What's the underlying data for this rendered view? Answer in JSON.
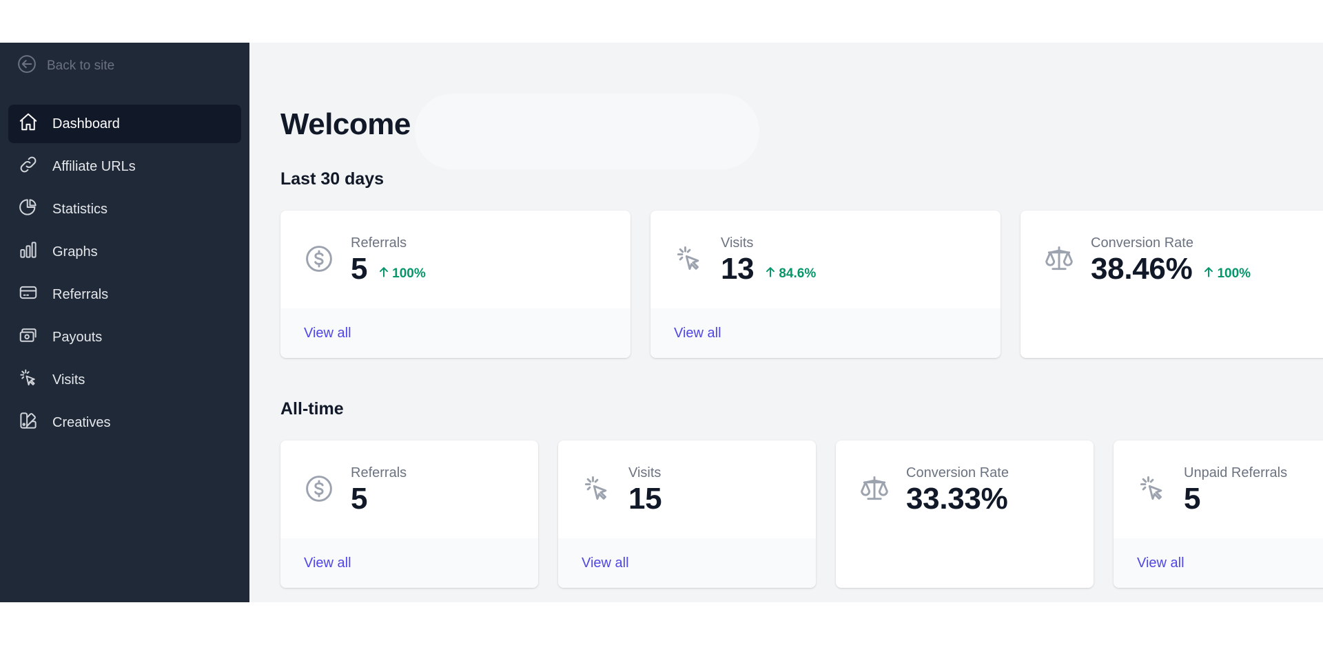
{
  "sidebar": {
    "back_label": "Back to site",
    "items": [
      {
        "label": "Dashboard",
        "icon": "home-icon",
        "active": true
      },
      {
        "label": "Affiliate URLs",
        "icon": "link-icon"
      },
      {
        "label": "Statistics",
        "icon": "pie-chart-icon"
      },
      {
        "label": "Graphs",
        "icon": "bar-chart-icon"
      },
      {
        "label": "Referrals",
        "icon": "credit-card-icon"
      },
      {
        "label": "Payouts",
        "icon": "cash-icon"
      },
      {
        "label": "Visits",
        "icon": "cursor-click-icon"
      },
      {
        "label": "Creatives",
        "icon": "color-swatch-icon"
      }
    ]
  },
  "main": {
    "welcome": "Welcome",
    "last30": {
      "title": "Last 30 days",
      "cards": [
        {
          "label": "Referrals",
          "value": "5",
          "change": "100%",
          "icon": "dollar-circle-icon",
          "link": "View all"
        },
        {
          "label": "Visits",
          "value": "13",
          "change": "84.6%",
          "icon": "cursor-click-icon",
          "link": "View all"
        },
        {
          "label": "Conversion Rate",
          "value": "38.46%",
          "change": "100%",
          "icon": "scale-icon"
        }
      ]
    },
    "alltime": {
      "title": "All-time",
      "cards": [
        {
          "label": "Referrals",
          "value": "5",
          "icon": "dollar-circle-icon",
          "link": "View all"
        },
        {
          "label": "Visits",
          "value": "15",
          "icon": "cursor-click-icon",
          "link": "View all"
        },
        {
          "label": "Conversion Rate",
          "value": "33.33%",
          "icon": "scale-icon"
        },
        {
          "label": "Unpaid Referrals",
          "value": "5",
          "icon": "cursor-click-icon",
          "link": "View all"
        }
      ]
    }
  },
  "colors": {
    "sidebar_bg": "#1f2937",
    "sidebar_active": "#111827",
    "main_bg": "#f3f4f6",
    "positive": "#059669",
    "link": "#4f46e5"
  }
}
